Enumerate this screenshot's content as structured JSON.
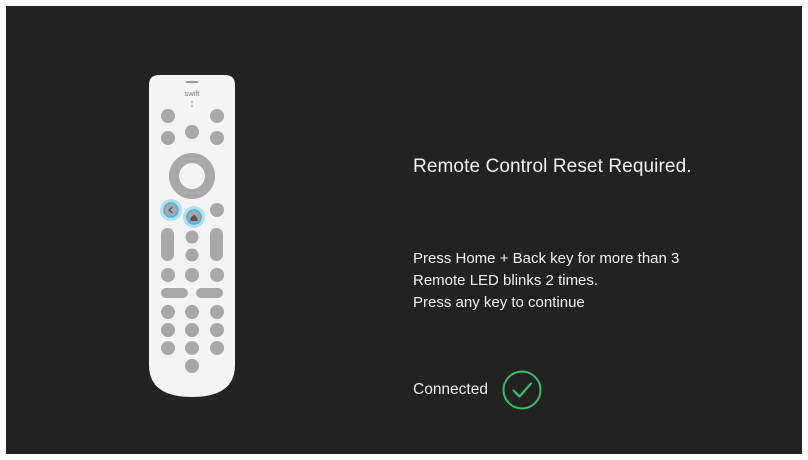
{
  "remote": {
    "brand": "swift",
    "icon": "remote-control-icon",
    "highlight_color": "#3fb6e6"
  },
  "dialog": {
    "title": "Remote Control Reset Required.",
    "instructions": [
      "Press Home + Back key for more than 3",
      "Remote LED blinks 2 times.",
      "Press any key to continue"
    ]
  },
  "status": {
    "label": "Connected",
    "icon": "check-circle-icon",
    "color": "#2ec26a"
  }
}
